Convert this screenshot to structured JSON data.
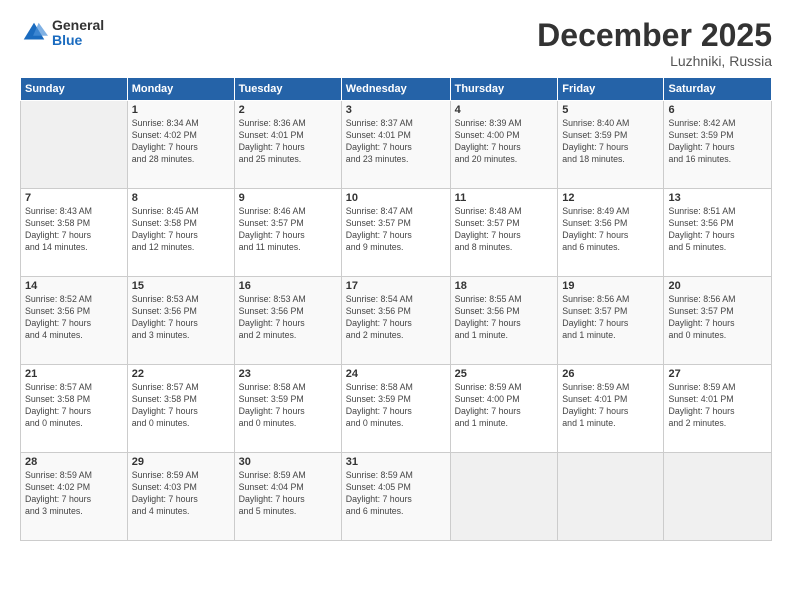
{
  "header": {
    "logo_general": "General",
    "logo_blue": "Blue",
    "month_title": "December 2025",
    "location": "Luzhniki, Russia"
  },
  "days_of_week": [
    "Sunday",
    "Monday",
    "Tuesday",
    "Wednesday",
    "Thursday",
    "Friday",
    "Saturday"
  ],
  "weeks": [
    [
      {
        "num": "",
        "info": ""
      },
      {
        "num": "1",
        "info": "Sunrise: 8:34 AM\nSunset: 4:02 PM\nDaylight: 7 hours\nand 28 minutes."
      },
      {
        "num": "2",
        "info": "Sunrise: 8:36 AM\nSunset: 4:01 PM\nDaylight: 7 hours\nand 25 minutes."
      },
      {
        "num": "3",
        "info": "Sunrise: 8:37 AM\nSunset: 4:01 PM\nDaylight: 7 hours\nand 23 minutes."
      },
      {
        "num": "4",
        "info": "Sunrise: 8:39 AM\nSunset: 4:00 PM\nDaylight: 7 hours\nand 20 minutes."
      },
      {
        "num": "5",
        "info": "Sunrise: 8:40 AM\nSunset: 3:59 PM\nDaylight: 7 hours\nand 18 minutes."
      },
      {
        "num": "6",
        "info": "Sunrise: 8:42 AM\nSunset: 3:59 PM\nDaylight: 7 hours\nand 16 minutes."
      }
    ],
    [
      {
        "num": "7",
        "info": "Sunrise: 8:43 AM\nSunset: 3:58 PM\nDaylight: 7 hours\nand 14 minutes."
      },
      {
        "num": "8",
        "info": "Sunrise: 8:45 AM\nSunset: 3:58 PM\nDaylight: 7 hours\nand 12 minutes."
      },
      {
        "num": "9",
        "info": "Sunrise: 8:46 AM\nSunset: 3:57 PM\nDaylight: 7 hours\nand 11 minutes."
      },
      {
        "num": "10",
        "info": "Sunrise: 8:47 AM\nSunset: 3:57 PM\nDaylight: 7 hours\nand 9 minutes."
      },
      {
        "num": "11",
        "info": "Sunrise: 8:48 AM\nSunset: 3:57 PM\nDaylight: 7 hours\nand 8 minutes."
      },
      {
        "num": "12",
        "info": "Sunrise: 8:49 AM\nSunset: 3:56 PM\nDaylight: 7 hours\nand 6 minutes."
      },
      {
        "num": "13",
        "info": "Sunrise: 8:51 AM\nSunset: 3:56 PM\nDaylight: 7 hours\nand 5 minutes."
      }
    ],
    [
      {
        "num": "14",
        "info": "Sunrise: 8:52 AM\nSunset: 3:56 PM\nDaylight: 7 hours\nand 4 minutes."
      },
      {
        "num": "15",
        "info": "Sunrise: 8:53 AM\nSunset: 3:56 PM\nDaylight: 7 hours\nand 3 minutes."
      },
      {
        "num": "16",
        "info": "Sunrise: 8:53 AM\nSunset: 3:56 PM\nDaylight: 7 hours\nand 2 minutes."
      },
      {
        "num": "17",
        "info": "Sunrise: 8:54 AM\nSunset: 3:56 PM\nDaylight: 7 hours\nand 2 minutes."
      },
      {
        "num": "18",
        "info": "Sunrise: 8:55 AM\nSunset: 3:56 PM\nDaylight: 7 hours\nand 1 minute."
      },
      {
        "num": "19",
        "info": "Sunrise: 8:56 AM\nSunset: 3:57 PM\nDaylight: 7 hours\nand 1 minute."
      },
      {
        "num": "20",
        "info": "Sunrise: 8:56 AM\nSunset: 3:57 PM\nDaylight: 7 hours\nand 0 minutes."
      }
    ],
    [
      {
        "num": "21",
        "info": "Sunrise: 8:57 AM\nSunset: 3:58 PM\nDaylight: 7 hours\nand 0 minutes."
      },
      {
        "num": "22",
        "info": "Sunrise: 8:57 AM\nSunset: 3:58 PM\nDaylight: 7 hours\nand 0 minutes."
      },
      {
        "num": "23",
        "info": "Sunrise: 8:58 AM\nSunset: 3:59 PM\nDaylight: 7 hours\nand 0 minutes."
      },
      {
        "num": "24",
        "info": "Sunrise: 8:58 AM\nSunset: 3:59 PM\nDaylight: 7 hours\nand 0 minutes."
      },
      {
        "num": "25",
        "info": "Sunrise: 8:59 AM\nSunset: 4:00 PM\nDaylight: 7 hours\nand 1 minute."
      },
      {
        "num": "26",
        "info": "Sunrise: 8:59 AM\nSunset: 4:01 PM\nDaylight: 7 hours\nand 1 minute."
      },
      {
        "num": "27",
        "info": "Sunrise: 8:59 AM\nSunset: 4:01 PM\nDaylight: 7 hours\nand 2 minutes."
      }
    ],
    [
      {
        "num": "28",
        "info": "Sunrise: 8:59 AM\nSunset: 4:02 PM\nDaylight: 7 hours\nand 3 minutes."
      },
      {
        "num": "29",
        "info": "Sunrise: 8:59 AM\nSunset: 4:03 PM\nDaylight: 7 hours\nand 4 minutes."
      },
      {
        "num": "30",
        "info": "Sunrise: 8:59 AM\nSunset: 4:04 PM\nDaylight: 7 hours\nand 5 minutes."
      },
      {
        "num": "31",
        "info": "Sunrise: 8:59 AM\nSunset: 4:05 PM\nDaylight: 7 hours\nand 6 minutes."
      },
      {
        "num": "",
        "info": ""
      },
      {
        "num": "",
        "info": ""
      },
      {
        "num": "",
        "info": ""
      }
    ]
  ]
}
